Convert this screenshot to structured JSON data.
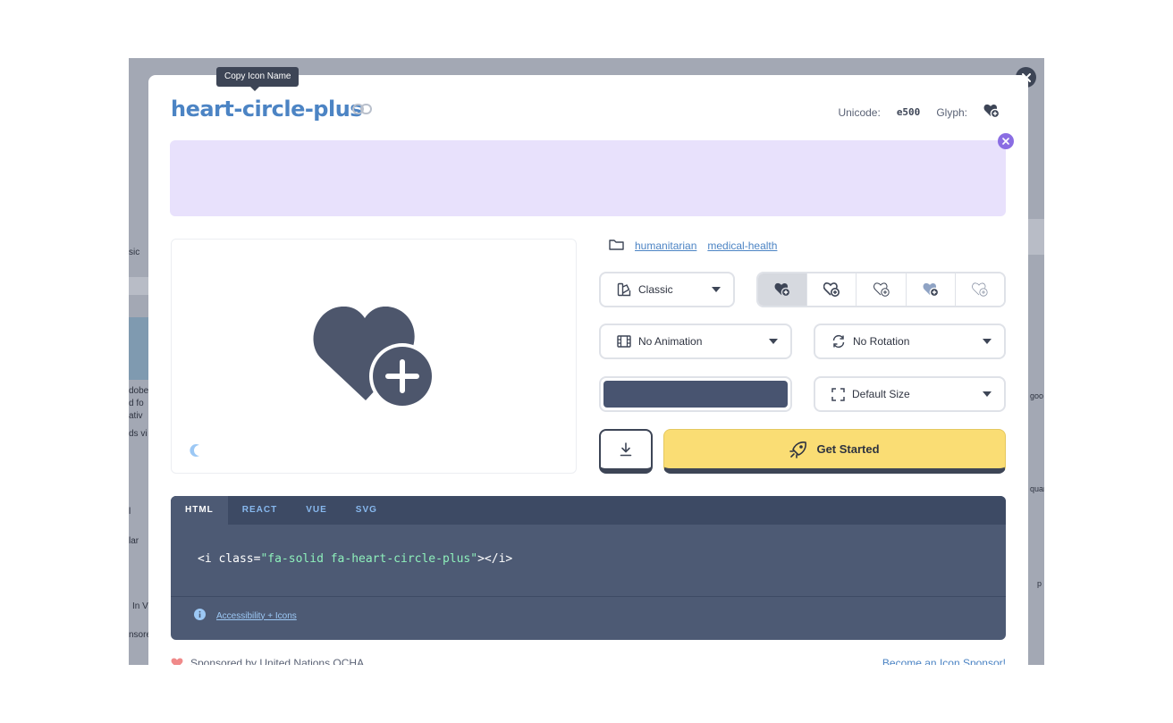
{
  "tooltip": "Copy Icon Name",
  "icon": {
    "name": "heart-circle-plus",
    "unicode_label": "Unicode:",
    "unicode_value": "e500",
    "glyph_label": "Glyph:"
  },
  "categories": [
    "humanitarian",
    "medical-health"
  ],
  "controls": {
    "family": "Classic",
    "animation": "No Animation",
    "rotation": "No Rotation",
    "size": "Default Size",
    "color": "#485470",
    "get_started": "Get Started"
  },
  "style_variants": [
    "solid",
    "regular",
    "light",
    "thin",
    "duotone"
  ],
  "code": {
    "tabs": [
      "HTML",
      "REACT",
      "VUE",
      "SVG"
    ],
    "active_tab": "HTML",
    "line_open": "<i class=",
    "line_value": "\"fa-solid fa-heart-circle-plus\"",
    "line_close": "></i>",
    "accessibility_link": "Accessibility + Icons"
  },
  "footer": {
    "sponsor_text": "Sponsored by United Nations OCHA",
    "sponsor_link": "Become an Icon Sponsor!"
  },
  "background": {
    "fragments": [
      "sic",
      "dobe",
      "d fo",
      "ativ",
      "ds vi",
      "l",
      "lar",
      "In V",
      "nsore",
      "goo",
      "quar",
      "p"
    ]
  },
  "colors": {
    "accent_blue": "#4c84c4",
    "banner": "#e8e1fc",
    "code_bg": "#4d5a74",
    "cta_yellow": "#fadd74"
  }
}
